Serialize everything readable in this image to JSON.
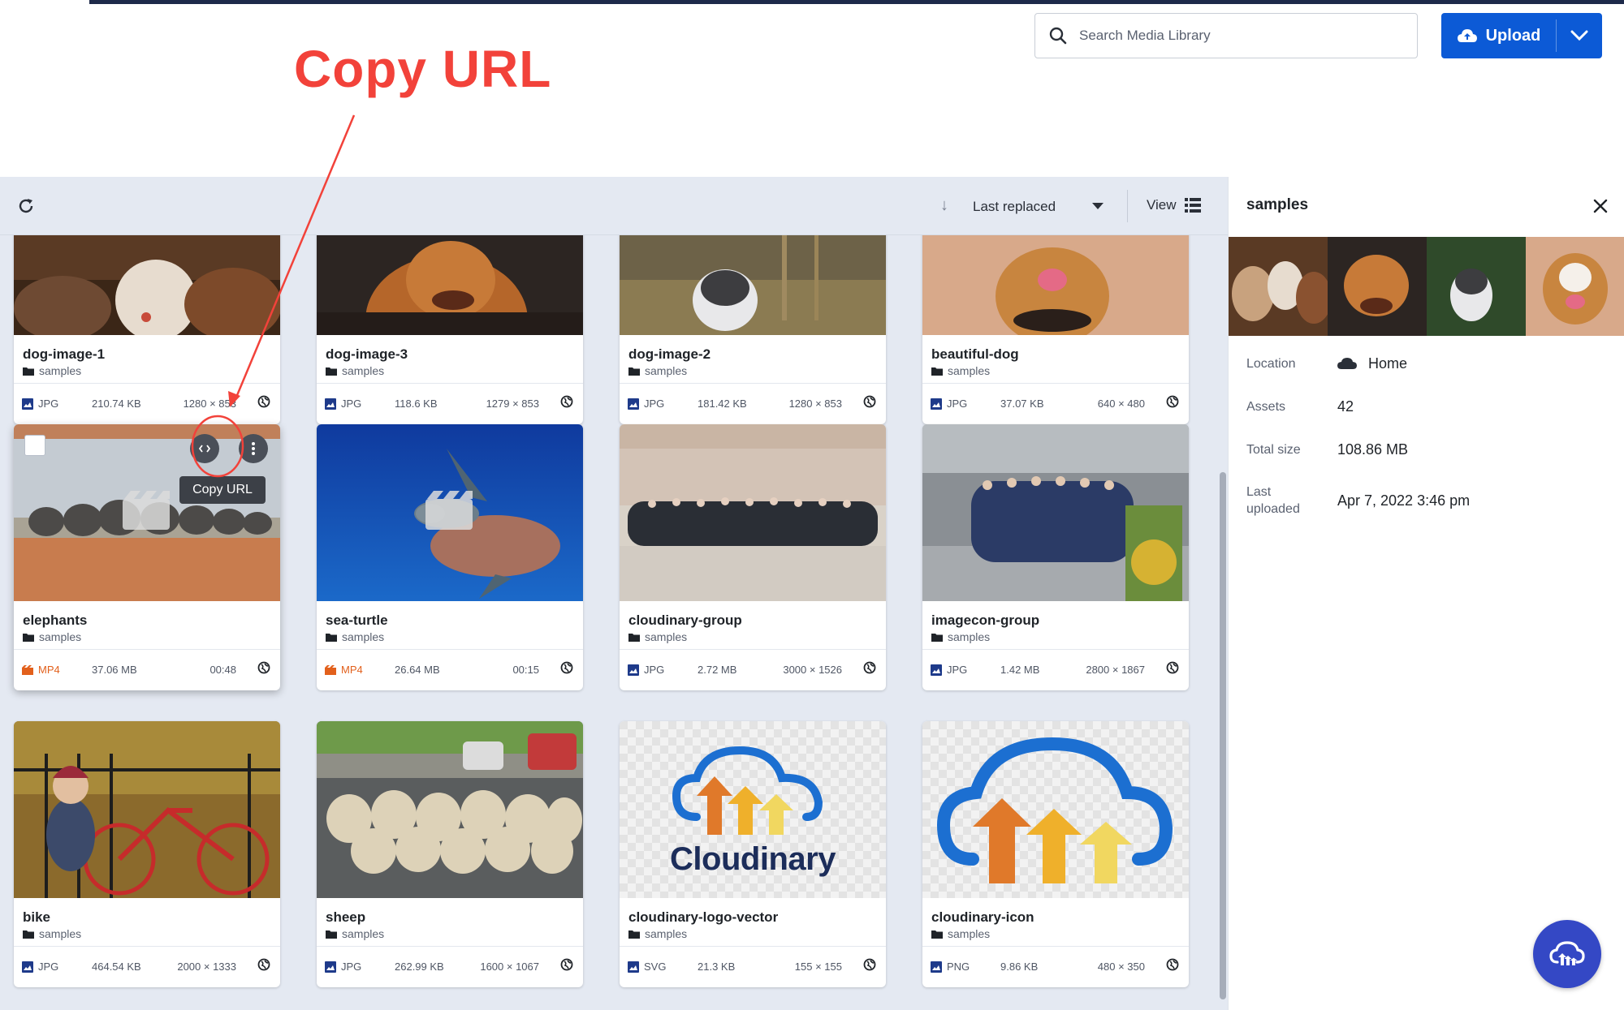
{
  "header": {
    "search_placeholder": "Search Media Library",
    "upload_label": "Upload"
  },
  "annotation": {
    "title": "Copy URL",
    "color": "#f2423a"
  },
  "toolbar": {
    "sort_label": "Last replaced",
    "view_label": "View"
  },
  "assets": [
    {
      "name": "dog-image-1",
      "folder": "samples",
      "type": "JPG",
      "size": "210.74 KB",
      "dims": "1280 × 853"
    },
    {
      "name": "dog-image-3",
      "folder": "samples",
      "type": "JPG",
      "size": "118.6 KB",
      "dims": "1279 × 853"
    },
    {
      "name": "dog-image-2",
      "folder": "samples",
      "type": "JPG",
      "size": "181.42 KB",
      "dims": "1280 × 853"
    },
    {
      "name": "beautiful-dog",
      "folder": "samples",
      "type": "JPG",
      "size": "37.07 KB",
      "dims": "640 × 480"
    },
    {
      "name": "elephants",
      "folder": "samples",
      "type": "MP4",
      "size": "37.06 MB",
      "dims": "00:48"
    },
    {
      "name": "sea-turtle",
      "folder": "samples",
      "type": "MP4",
      "size": "26.64 MB",
      "dims": "00:15"
    },
    {
      "name": "cloudinary-group",
      "folder": "samples",
      "type": "JPG",
      "size": "2.72 MB",
      "dims": "3000 × 1526"
    },
    {
      "name": "imagecon-group",
      "folder": "samples",
      "type": "JPG",
      "size": "1.42 MB",
      "dims": "2800 × 1867"
    },
    {
      "name": "bike",
      "folder": "samples",
      "type": "JPG",
      "size": "464.54 KB",
      "dims": "2000 × 1333"
    },
    {
      "name": "sheep",
      "folder": "samples",
      "type": "JPG",
      "size": "262.99 KB",
      "dims": "1600 × 1067"
    },
    {
      "name": "cloudinary-logo-vector",
      "folder": "samples",
      "type": "SVG",
      "size": "21.3 KB",
      "dims": "155 × 155"
    },
    {
      "name": "cloudinary-icon",
      "folder": "samples",
      "type": "PNG",
      "size": "9.86 KB",
      "dims": "480 × 350"
    }
  ],
  "hover_card": {
    "tooltip": "Copy URL"
  },
  "thumbnail_text": {
    "cloudinary_logo": "Cloudinary"
  },
  "panel": {
    "title": "samples",
    "location_label": "Location",
    "location_value": "Home",
    "assets_label": "Assets",
    "assets_value": "42",
    "total_size_label": "Total size",
    "total_size_value": "108.86 MB",
    "last_uploaded_label_1": "Last",
    "last_uploaded_label_2": "uploaded",
    "last_uploaded_value": "Apr 7, 2022 3:46 pm"
  },
  "colors": {
    "primary": "#0c5ad6",
    "video_type": "#e2601c",
    "fab": "#3448c5"
  }
}
